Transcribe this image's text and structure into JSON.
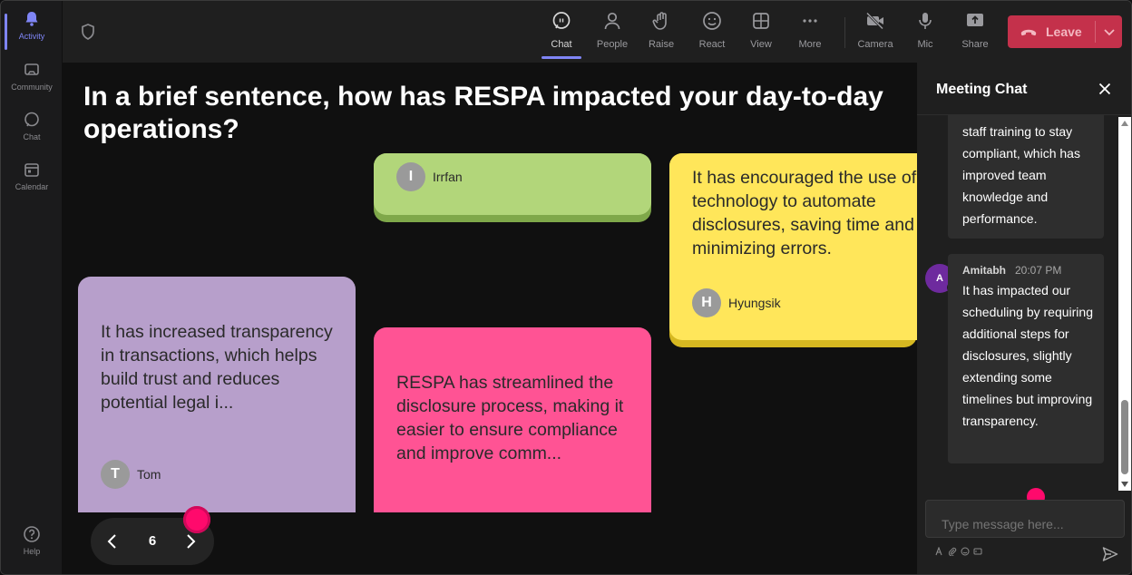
{
  "rail": {
    "items": [
      {
        "label": "Activity",
        "icon": "bell-icon"
      },
      {
        "label": "Community",
        "icon": "community-icon"
      },
      {
        "label": "Chat",
        "icon": "chat-icon"
      },
      {
        "label": "Calendar",
        "icon": "calendar-icon"
      },
      {
        "label": "Help",
        "icon": "help-icon"
      }
    ]
  },
  "toolbar": {
    "chat": "Chat",
    "people": "People",
    "raise": "Raise",
    "react": "React",
    "view": "View",
    "more": "More",
    "camera": "Camera",
    "mic": "Mic",
    "share": "Share",
    "leave": "Leave"
  },
  "stage": {
    "question": "In a brief sentence, how has RESPA impacted your day-to-day operations?",
    "notes": [
      {
        "color": "#b2d67a",
        "text": "",
        "author": "Irrfan",
        "initial": "I"
      },
      {
        "color": "#ffe65a",
        "text": "It has encouraged the use of technology to automate disclosures, saving time and minimizing errors.",
        "author": "Hyungsik",
        "initial": "H"
      },
      {
        "color": "#b79fcb",
        "text": "It has increased transparency in transactions, which helps build trust and reduces potential legal i...",
        "author": "Tom",
        "initial": "T"
      },
      {
        "color": "#ff5394",
        "text": "RESPA has streamlined the disclosure process, making it easier to ensure compliance and improve comm...",
        "author": "",
        "initial": ""
      }
    ],
    "page": "6"
  },
  "chat": {
    "title": "Meeting Chat",
    "prev_message": "staff training to stay compliant, which has improved team knowledge and performance.",
    "message": {
      "sender": "Amitabh",
      "initial": "A",
      "time": "20:07 PM",
      "text": "It has impacted our scheduling by requiring additional steps for disclosures, slightly extending some timelines but improving transparency."
    },
    "input_placeholder": "Type message here..."
  },
  "colors": {
    "accent": "#7f85f5",
    "leave": "#c4314b",
    "pointer_dot": "#ff0a6c"
  }
}
